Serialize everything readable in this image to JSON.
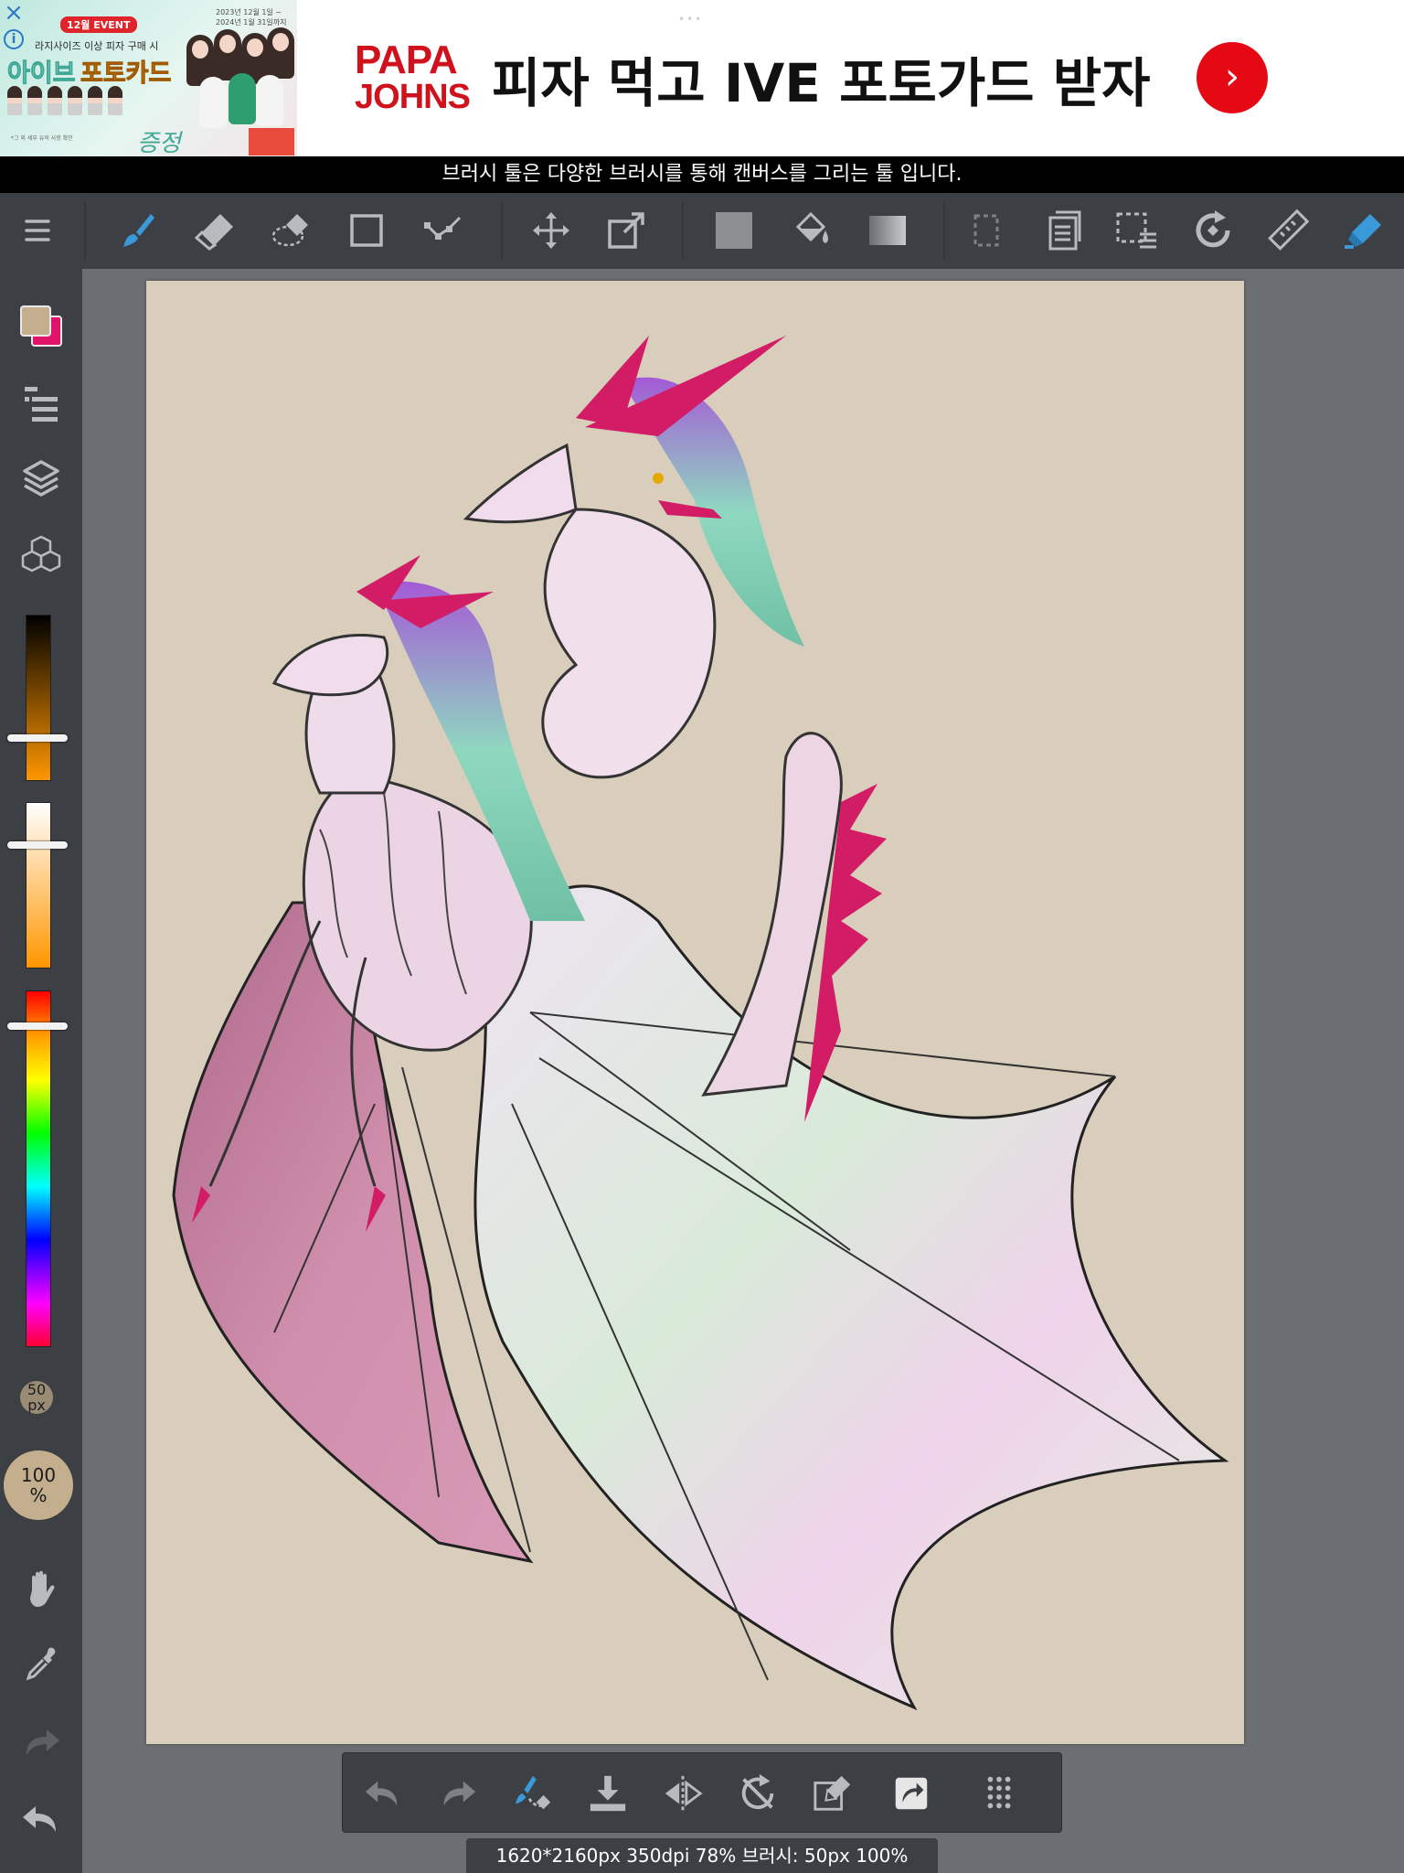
{
  "ad": {
    "event_badge": "12월 EVENT",
    "date_range": "2023년 12월 1일 ~ 2024년 1월 31일까지",
    "promo_line": "라지사이즈 이상 피자 구매 시",
    "idol_text": "아이브",
    "card_text": "포토카드",
    "gift_text": "증정",
    "fine_print": "*그 외 세부 유의 사항 확인",
    "brand_line1": "PAPA",
    "brand_line2": "JOHNS",
    "headline": "피자 먹고 IVE 포토가드 받자",
    "close_icon": "×",
    "info_icon": "i",
    "arrow_icon": "›",
    "more_dots": "•••"
  },
  "hint_text": "브러시 툴은 다양한 브러시를 통해 캔버스를 그리는 툴 입니다.",
  "toolbar": {
    "tools": [
      "menu-icon",
      "brush-icon",
      "eraser-icon",
      "lasso-eraser-icon",
      "shape-icon",
      "vector-icon",
      "move-icon",
      "transform-icon",
      "fill-color-icon",
      "bucket-icon",
      "gradient-icon",
      "select-icon",
      "copy-layer-icon",
      "select-menu-icon",
      "rotate-icon",
      "ruler-icon",
      "marker-icon"
    ],
    "active_tool": "brush-icon",
    "accent_color": "#3a9ad9"
  },
  "colors": {
    "foreground": "#c3ae8e",
    "background": "#e0126a"
  },
  "left_panel": {
    "brush_size": "50\npx",
    "opacity": "100\n%",
    "icons": [
      "color-icon",
      "brush-list-icon",
      "layers-icon",
      "materials-icon",
      "hand-icon",
      "eyedropper-icon",
      "redo-icon",
      "undo-icon"
    ]
  },
  "sliders": {
    "value_level": 0.74,
    "saturation_level": 0.26,
    "hue_level": 0.1
  },
  "bottom_toolbar": {
    "icons": [
      "undo-icon",
      "redo-icon",
      "brush-settings-icon",
      "save-icon",
      "flip-icon",
      "rotate-reset-icon",
      "edit-icon",
      "share-icon",
      "grid-icon"
    ]
  },
  "status_text": "1620*2160px 350dpi 78% 브러시: 50px 100%"
}
